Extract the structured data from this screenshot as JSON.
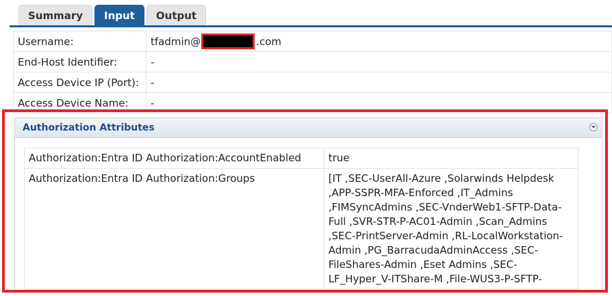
{
  "tabs": [
    {
      "label": "Summary",
      "active": false
    },
    {
      "label": "Input",
      "active": true
    },
    {
      "label": "Output",
      "active": false
    }
  ],
  "colors": {
    "tab_active": "#1e5f9c",
    "highlight_red": "#e3242b",
    "panel_title": "#1e4f86"
  },
  "info": {
    "username_label": "Username:",
    "username_prefix": "tfadmin@",
    "username_suffix": ".com",
    "endhost_label": "End-Host Identifier:",
    "endhost_value": "-",
    "access_ip_label": "Access Device IP (Port):",
    "access_ip_value": "-",
    "access_name_label": "Access Device Name:",
    "access_name_value": "-"
  },
  "authorization": {
    "title": "Authorization Attributes",
    "collapse_icon": "chevron-down-circle-icon",
    "rows": [
      {
        "name": "Authorization:Entra ID Authorization:AccountEnabled",
        "value": "true"
      },
      {
        "name": "Authorization:Entra ID Authorization:Groups",
        "value_lines": [
          "[IT ,SEC-UserAll-Azure ,Solarwinds Helpdesk",
          ",APP-SSPR-MFA-Enforced ,IT_Admins",
          ",FIMSyncAdmins ,SEC-VnderWeb1-SFTP-Data-",
          "Full ,SVR-STR-P-AC01-Admin ,Scan_Admins",
          ",SEC-PrintServer-Admin ,RL-LocalWorkstation-",
          "Admin ,PG_BarracudaAdminAccess ,SEC-",
          "FileShares-Admin ,Eset Admins ,SEC-",
          "LF_Hyper_V-ITShare-M ,File-WUS3-P-SFTP-"
        ]
      }
    ]
  }
}
